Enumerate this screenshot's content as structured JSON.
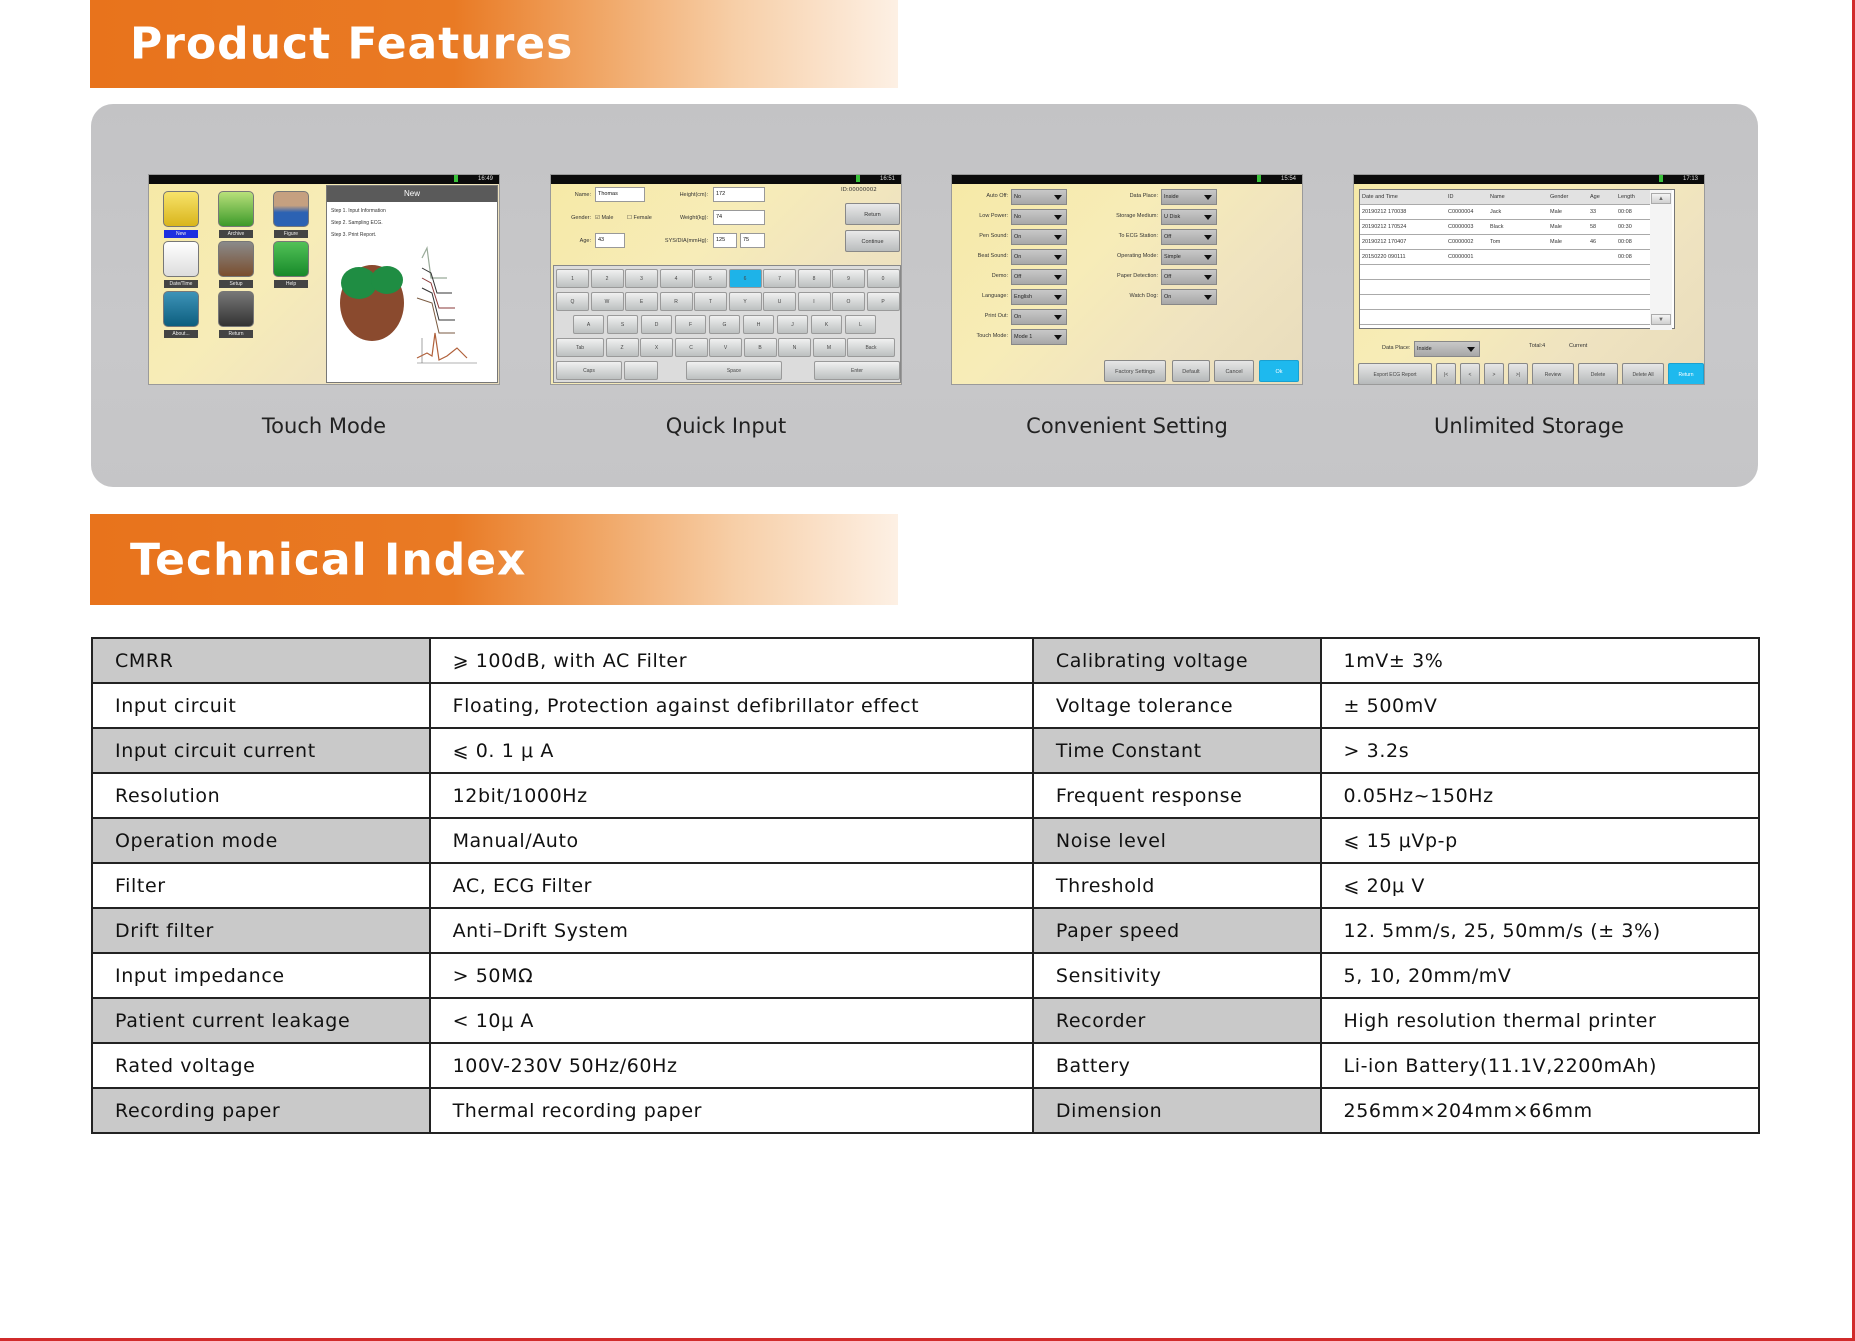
{
  "sections": {
    "features_title": "Product Features",
    "technical_title": "Technical Index"
  },
  "colors": {
    "banner_orange": "#e8731c",
    "panel_gray": "#c6c6c8",
    "table_shade": "#c9c9c9",
    "accent_cyan": "#1eb9ee",
    "border_red": "#d12b2b"
  },
  "features": [
    {
      "caption": "Touch Mode",
      "screen": {
        "time": "16:49",
        "icons": [
          "New",
          "Archive",
          "Figure",
          "Date/Time",
          "Setup",
          "Help",
          "About...",
          "Return"
        ],
        "pane_title": "New",
        "steps": [
          "Step 1. Input Information",
          "Step 2. Sampling ECG.",
          "Step 3. Print Report."
        ]
      }
    },
    {
      "caption": "Quick Input",
      "screen": {
        "time": "16:51",
        "id": "ID:00000002",
        "name_label": "Name:",
        "name_value": "Thomas",
        "gender_label": "Gender:",
        "male": "Male",
        "female": "Female",
        "age_label": "Age:",
        "age_value": "43",
        "height_label": "Height(cm):",
        "height_value": "172",
        "weight_label": "Weight(kg):",
        "weight_value": "74",
        "bp_label": "SYS/DIA(mmHg):",
        "sys_value": "125",
        "dia_value": "75",
        "return": "Return",
        "continue": "Continue",
        "keys_row1": [
          "1",
          "2",
          "3",
          "4",
          "5",
          "6",
          "7",
          "8",
          "9",
          "0"
        ],
        "keys_row2": [
          "Q",
          "W",
          "E",
          "R",
          "T",
          "Y",
          "U",
          "I",
          "O",
          "P"
        ],
        "keys_row3": [
          "A",
          "S",
          "D",
          "F",
          "G",
          "H",
          "J",
          "K",
          "L"
        ],
        "keys_row4": [
          "Tab",
          "Z",
          "X",
          "C",
          "V",
          "B",
          "N",
          "M",
          "Back"
        ],
        "keys_row5": [
          "Caps",
          "",
          "Space",
          "Enter"
        ]
      }
    },
    {
      "caption": "Convenient Setting",
      "screen": {
        "time": "15:54",
        "left": [
          {
            "label": "Auto Off:",
            "value": "No"
          },
          {
            "label": "Low Power:",
            "value": "No"
          },
          {
            "label": "Pen Sound:",
            "value": "On"
          },
          {
            "label": "Beat Sound:",
            "value": "On"
          },
          {
            "label": "Demo:",
            "value": "Off"
          },
          {
            "label": "Language:",
            "value": "English"
          },
          {
            "label": "Print Out:",
            "value": "On"
          },
          {
            "label": "Touch Mode:",
            "value": "Mode 1"
          }
        ],
        "right": [
          {
            "label": "Data Place:",
            "value": "Inside"
          },
          {
            "label": "Storage Medium:",
            "value": "U Disk"
          },
          {
            "label": "To ECG Station:",
            "value": "Off"
          },
          {
            "label": "Operating Mode:",
            "value": "Simple"
          },
          {
            "label": "Paper Detection:",
            "value": "Off"
          },
          {
            "label": "Watch Dog:",
            "value": "On"
          }
        ],
        "buttons": [
          "Factory Settings",
          "Default",
          "Cancel",
          "Ok"
        ]
      }
    },
    {
      "caption": "Unlimited Storage",
      "screen": {
        "time": "17:13",
        "columns": [
          "Date and Time",
          "ID",
          "Name",
          "Gender",
          "Age",
          "Length"
        ],
        "rows": [
          [
            "20190212 170038",
            "C0000004",
            "Jack",
            "Male",
            "33",
            "00:08"
          ],
          [
            "20190212 170524",
            "C0000003",
            "Black",
            "Male",
            "58",
            "00:30"
          ],
          [
            "20190212 170407",
            "C0000002",
            "Tom",
            "Male",
            "46",
            "00:08"
          ],
          [
            "20150220 090111",
            "C0000001",
            "",
            "",
            "",
            "00:08"
          ]
        ],
        "data_place_label": "Data Place:",
        "data_place_value": "Inside",
        "total": "Total:4",
        "current": "Current",
        "buttons": [
          "Export ECG Report",
          "|<",
          "<",
          ">",
          ">|",
          "Review",
          "Delete",
          "Delete All",
          "Return"
        ]
      }
    }
  ],
  "spec_table": {
    "rows": [
      {
        "l1": "CMRR",
        "v1": "⩾ 100dB, with AC Filter",
        "l2": "Calibrating voltage",
        "v2": "1mV± 3%"
      },
      {
        "l1": "Input  circuit",
        "v1": "Floating, Protection against defibrillator effect",
        "l2": "Voltage  tolerance",
        "v2": "± 500mV"
      },
      {
        "l1": "Input  circuit  current",
        "v1": "⩽  0. 1 μ A",
        "l2": "Time  Constant",
        "v2": "> 3.2s"
      },
      {
        "l1": "Resolution",
        "v1": "12bit/1000Hz",
        "l2": "Frequent response",
        "v2": "0.05Hz~150Hz"
      },
      {
        "l1": "Operation  mode",
        "v1": "Manual/Auto",
        "l2": "Noise  level",
        "v2": "⩽  15 μVp-p"
      },
      {
        "l1": "Filter",
        "v1": "AC, ECG  Filter",
        "l2": "Threshold",
        "v2": "⩽  20μ V"
      },
      {
        "l1": "Drift  filter",
        "v1": "Anti–Drift  System",
        "l2": "Paper speed",
        "v2": "12. 5mm/s, 25,  50mm/s (± 3%)"
      },
      {
        "l1": "Input  impedance",
        "v1": "> 50MΩ",
        "l2": "Sensitivity",
        "v2": "5,  10,  20mm/mV"
      },
      {
        "l1": "Patient  current  leakage",
        "v1": "< 10μ A",
        "l2": "Recorder",
        "v2": "High  resolution  thermal  printer"
      },
      {
        "l1": "Rated voltage",
        "v1": "100V-230V  50Hz/60Hz",
        "l2": "Battery",
        "v2": "Li-ion Battery(11.1V,2200mAh)"
      },
      {
        "l1": "Recording  paper",
        "v1": "Thermal  recording  paper",
        "l2": "Dimension",
        "v2": "256mm×204mm×66mm"
      }
    ]
  }
}
